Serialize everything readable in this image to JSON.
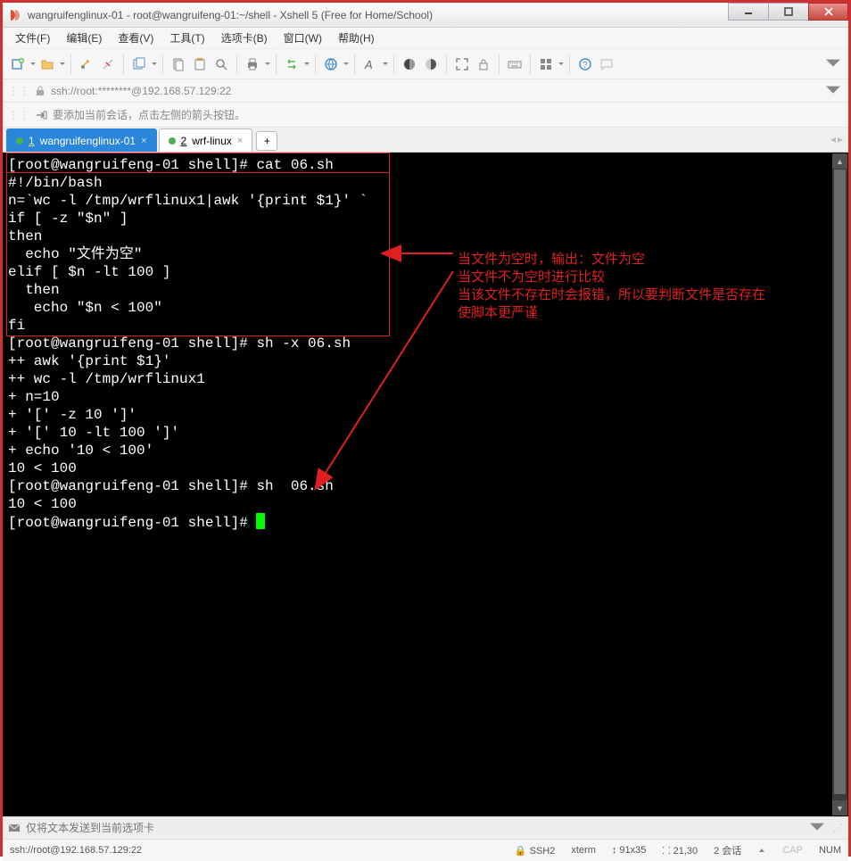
{
  "window": {
    "title": "wangruifenglinux-01 - root@wangruifeng-01:~/shell - Xshell 5 (Free for Home/School)"
  },
  "menu": {
    "file": "文件(F)",
    "edit": "编辑(E)",
    "view": "查看(V)",
    "tools": "工具(T)",
    "tabs": "选项卡(B)",
    "window": "窗口(W)",
    "help": "帮助(H)"
  },
  "addressbar": {
    "text": "ssh://root:********@192.168.57.129:22"
  },
  "infobar": {
    "text": "要添加当前会话，点击左侧的箭头按钮。"
  },
  "tabs": {
    "t1": {
      "index": "1",
      "label": "wangruifenglinux-01"
    },
    "t2": {
      "index": "2",
      "label": "wrf-linux"
    },
    "add": "+"
  },
  "terminal": {
    "line01": "[root@wangruifeng-01 shell]# cat 06.sh",
    "line02": "#!/bin/bash",
    "line03": "n=`wc -l /tmp/wrflinux1|awk '{print $1}' `",
    "line04": "if [ -z \"$n\" ]",
    "line05": "then",
    "line06": "  echo \"文件为空\"",
    "line07": "elif [ $n -lt 100 ]",
    "line08": "  then",
    "line09": "   echo \"$n < 100\"",
    "line10": "fi",
    "line11": "[root@wangruifeng-01 shell]# sh -x 06.sh",
    "line12": "++ awk '{print $1}'",
    "line13": "++ wc -l /tmp/wrflinux1",
    "line14": "+ n=10",
    "line15": "+ '[' -z 10 ']'",
    "line16": "+ '[' 10 -lt 100 ']'",
    "line17": "+ echo '10 < 100'",
    "line18": "10 < 100",
    "line19": "[root@wangruifeng-01 shell]# sh  06.sh",
    "line20": "10 < 100",
    "line21": "[root@wangruifeng-01 shell]# "
  },
  "annotations": {
    "a1": "当文件为空时，输出：文件为空",
    "a2": "当文件不为空时进行比较",
    "a3": "当该文件不存在时会报错，所以要判断文件是否存在",
    "a4": "使脚本更严谨"
  },
  "sendbar": {
    "placeholder": "仅将文本发送到当前选项卡"
  },
  "statusbar": {
    "left": "ssh://root@192.168.57.129:22",
    "ssh": "SSH2",
    "term": "xterm",
    "size": "91x35",
    "pos": "21,30",
    "sessions": "2 会话",
    "cap": "CAP",
    "num": "NUM"
  }
}
